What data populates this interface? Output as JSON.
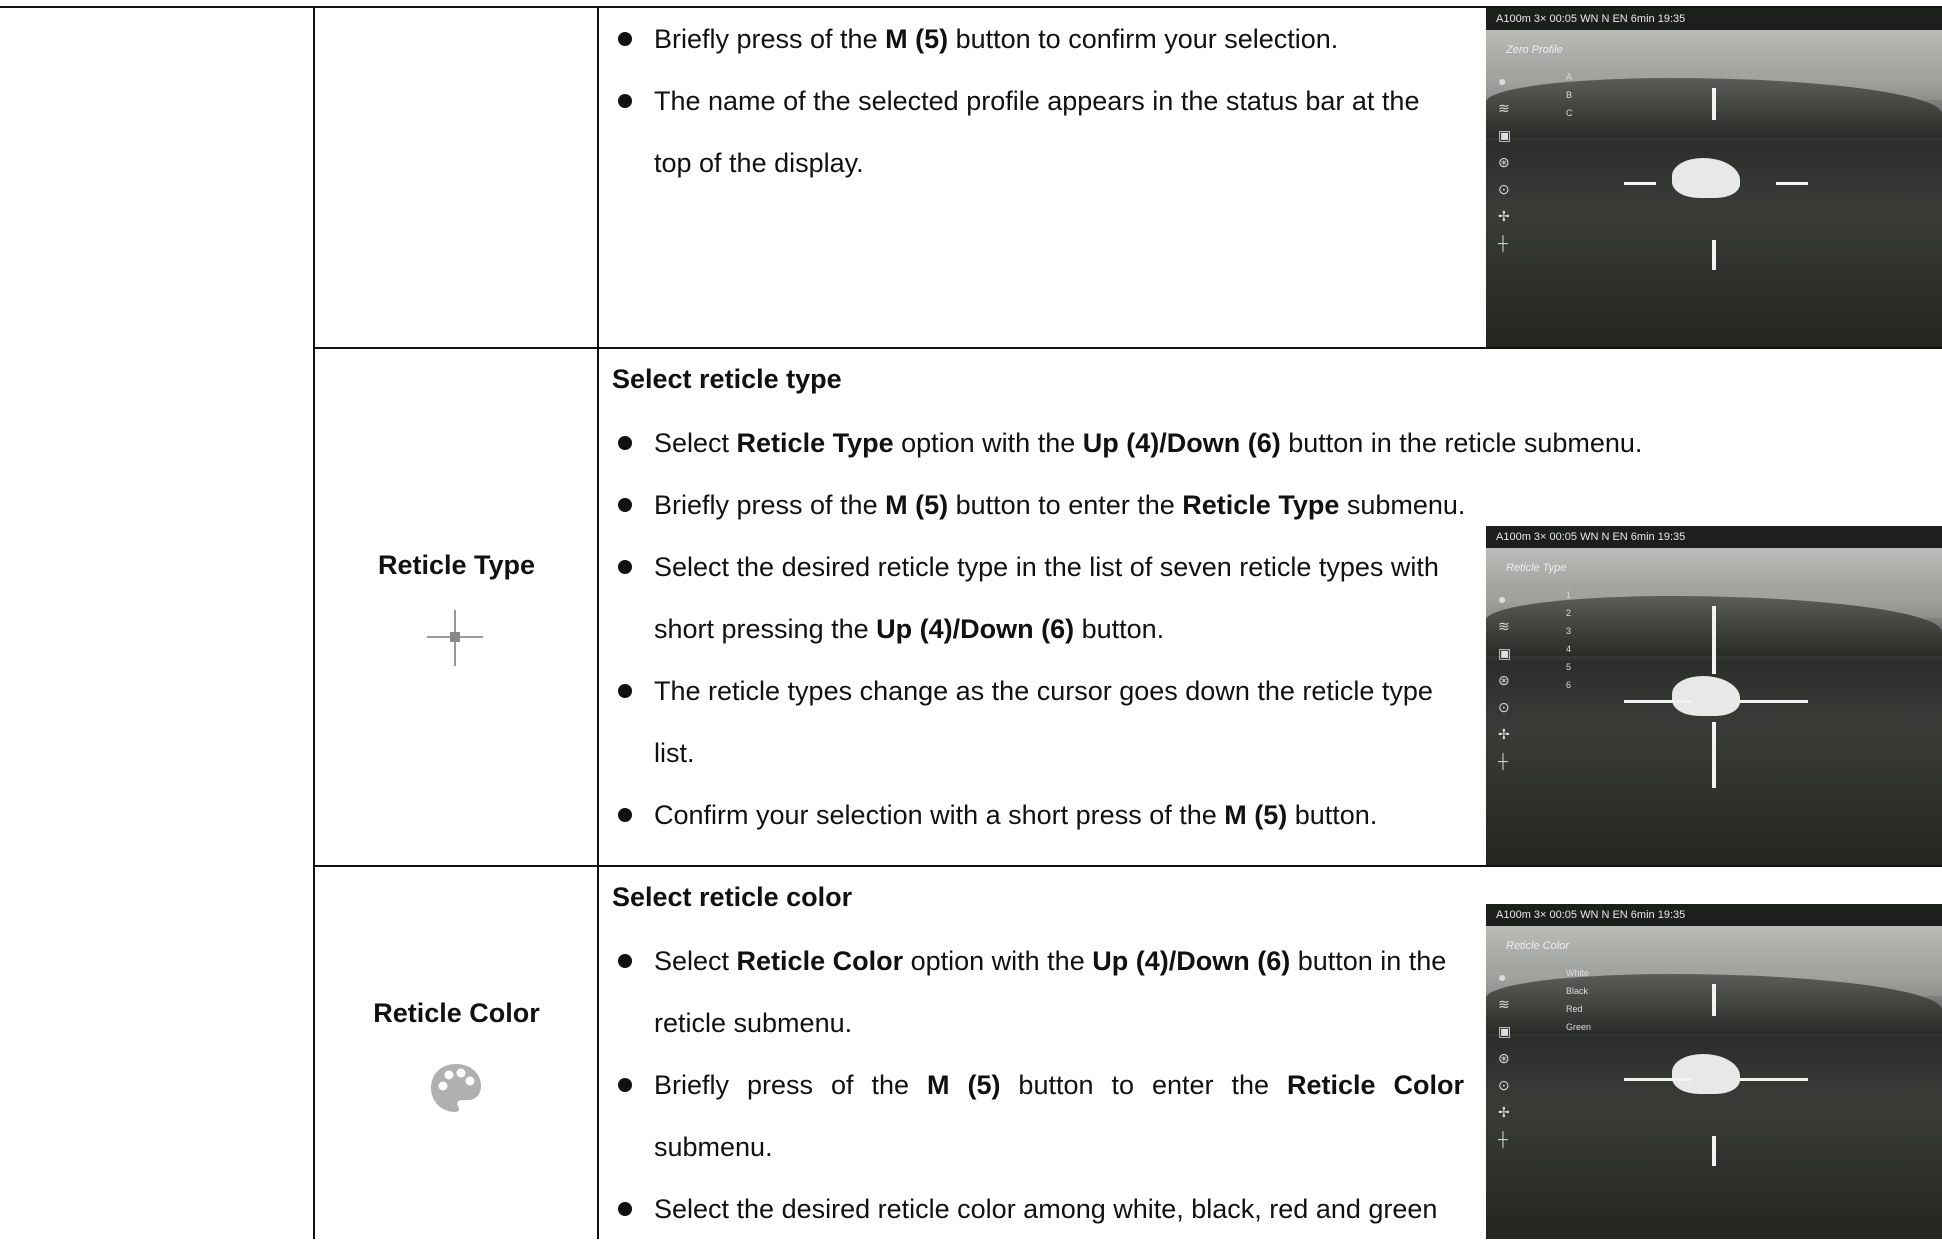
{
  "rows": [
    {
      "label": "",
      "heading": "",
      "bullets": [
        {
          "parts": [
            {
              "t": "Briefly press of the "
            },
            {
              "t": "M (5)",
              "b": true
            },
            {
              "t": " button to confirm your selection."
            }
          ]
        },
        {
          "parts": [
            {
              "t": "The name of the selected profile appears in the status bar at the top of the display."
            }
          ]
        }
      ],
      "screenshot": {
        "menu_title": "Zero Profile",
        "options": [
          "A",
          "B",
          "C"
        ]
      }
    },
    {
      "label": "Reticle Type",
      "icon": "crosshair-icon",
      "heading": "Select reticle type",
      "bullets": [
        {
          "parts": [
            {
              "t": "Select "
            },
            {
              "t": "Reticle Type",
              "b": true
            },
            {
              "t": " option with the "
            },
            {
              "t": "Up (4)/Down (6)",
              "b": true
            },
            {
              "t": " button in the reticle submenu."
            }
          ]
        },
        {
          "parts": [
            {
              "t": "Briefly press of the "
            },
            {
              "t": "M (5)",
              "b": true
            },
            {
              "t": " button to enter the "
            },
            {
              "t": "Reticle Type",
              "b": true
            },
            {
              "t": " submenu."
            }
          ]
        },
        {
          "parts": [
            {
              "t": "Select the desired reticle type in the list of seven reticle types with short pressing the "
            },
            {
              "t": "Up (4)/Down (6)",
              "b": true
            },
            {
              "t": " button."
            }
          ]
        },
        {
          "parts": [
            {
              "t": "The reticle types change as the cursor goes down the reticle type list."
            }
          ]
        },
        {
          "parts": [
            {
              "t": "Confirm your selection with a short press of the "
            },
            {
              "t": "M (5)",
              "b": true
            },
            {
              "t": " button."
            }
          ]
        }
      ],
      "screenshot": {
        "menu_title": "Reticle Type",
        "options": [
          "1",
          "2",
          "3",
          "4",
          "5",
          "6"
        ]
      }
    },
    {
      "label": "Reticle Color",
      "icon": "palette-icon",
      "heading": "Select reticle color",
      "bullets": [
        {
          "parts": [
            {
              "t": "Select "
            },
            {
              "t": "Reticle Color",
              "b": true
            },
            {
              "t": " option with the "
            },
            {
              "t": "Up (4)/Down (6)",
              "b": true
            },
            {
              "t": " button in the reticle submenu."
            }
          ]
        },
        {
          "parts": [
            {
              "t": "Briefly press of the "
            },
            {
              "t": "M (5)",
              "b": true
            },
            {
              "t": " button to enter the "
            },
            {
              "t": "Reticle Color",
              "b": true
            },
            {
              "t": " submenu."
            }
          ]
        },
        {
          "parts": [
            {
              "t": "Select the desired reticle color among white, black, red and green"
            }
          ]
        }
      ],
      "screenshot": {
        "menu_title": "Reticle Color",
        "options": [
          "White",
          "Black",
          "Red",
          "Green"
        ]
      }
    }
  ],
  "status_bar": "A100m   3×   00:05   WN  N  EN   6min   19:35"
}
